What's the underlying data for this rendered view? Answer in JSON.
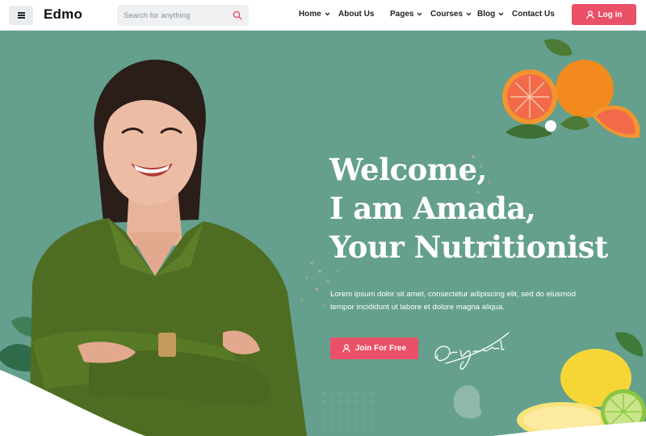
{
  "header": {
    "logo": "Edmo",
    "search_placeholder": "Search for anything",
    "nav": [
      {
        "label": "Home",
        "has_dropdown": true
      },
      {
        "label": "About Us",
        "has_dropdown": false
      },
      {
        "label": "Pages",
        "has_dropdown": true
      },
      {
        "label": "Courses",
        "has_dropdown": true
      },
      {
        "label": "Blog",
        "has_dropdown": true
      },
      {
        "label": "Contact Us",
        "has_dropdown": false
      }
    ],
    "login_label": "Log in"
  },
  "hero": {
    "headline": [
      "Welcome,",
      "I am Amada,",
      "Your Nutritionist"
    ],
    "intro_line1": "Lorem ipsum dolor sit amet, consectetur adipiscing elit, sed do eiusmod",
    "intro_line2": "tempor incididunt ut labore et dolore magna aliqua.",
    "cta_label": "Join For Free",
    "signature": "Original"
  },
  "colors": {
    "accent": "#ea5067",
    "hero_background": "#64a08d",
    "header_background": "#ffffff",
    "text_dark": "#222222"
  },
  "icons": {
    "menu": "hamburger-icon",
    "search": "search-icon",
    "dropdown": "chevron-down-icon",
    "user": "user-icon"
  }
}
